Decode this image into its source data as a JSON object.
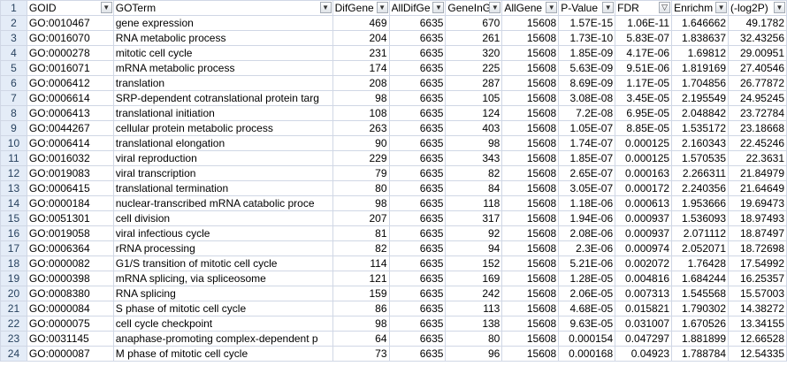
{
  "columns": [
    {
      "label": "GOID",
      "align": "txt",
      "filtered": false
    },
    {
      "label": "GOTerm",
      "align": "txt",
      "filtered": false
    },
    {
      "label": "DifGene",
      "align": "num",
      "filtered": false
    },
    {
      "label": "AllDifGe",
      "align": "num",
      "filtered": false
    },
    {
      "label": "GeneInG",
      "align": "num",
      "filtered": false
    },
    {
      "label": "AllGene",
      "align": "num",
      "filtered": false
    },
    {
      "label": "P-Value",
      "align": "num",
      "filtered": false
    },
    {
      "label": "FDR",
      "align": "num",
      "filtered": true
    },
    {
      "label": "Enrichm",
      "align": "num",
      "filtered": false
    },
    {
      "label": "(-log2P)",
      "align": "num",
      "filtered": false
    }
  ],
  "row_numbers": [
    "1",
    "2",
    "3",
    "4",
    "5",
    "6",
    "7",
    "8",
    "9",
    "10",
    "11",
    "12",
    "13",
    "14",
    "15",
    "16",
    "17",
    "18",
    "19",
    "20",
    "21",
    "22",
    "23",
    "24"
  ],
  "rows": [
    [
      "GO:0010467",
      "gene expression",
      "469",
      "6635",
      "670",
      "15608",
      "1.57E-15",
      "1.06E-11",
      "1.646662",
      "49.1782"
    ],
    [
      "GO:0016070",
      "RNA metabolic process",
      "204",
      "6635",
      "261",
      "15608",
      "1.73E-10",
      "5.83E-07",
      "1.838637",
      "32.43256"
    ],
    [
      "GO:0000278",
      "mitotic cell cycle",
      "231",
      "6635",
      "320",
      "15608",
      "1.85E-09",
      "4.17E-06",
      "1.69812",
      "29.00951"
    ],
    [
      "GO:0016071",
      "mRNA metabolic process",
      "174",
      "6635",
      "225",
      "15608",
      "5.63E-09",
      "9.51E-06",
      "1.819169",
      "27.40546"
    ],
    [
      "GO:0006412",
      "translation",
      "208",
      "6635",
      "287",
      "15608",
      "8.69E-09",
      "1.17E-05",
      "1.704856",
      "26.77872"
    ],
    [
      "GO:0006614",
      "SRP-dependent cotranslational protein targ",
      "98",
      "6635",
      "105",
      "15608",
      "3.08E-08",
      "3.45E-05",
      "2.195549",
      "24.95245"
    ],
    [
      "GO:0006413",
      "translational initiation",
      "108",
      "6635",
      "124",
      "15608",
      "7.2E-08",
      "6.95E-05",
      "2.048842",
      "23.72784"
    ],
    [
      "GO:0044267",
      "cellular protein metabolic process",
      "263",
      "6635",
      "403",
      "15608",
      "1.05E-07",
      "8.85E-05",
      "1.535172",
      "23.18668"
    ],
    [
      "GO:0006414",
      "translational elongation",
      "90",
      "6635",
      "98",
      "15608",
      "1.74E-07",
      "0.000125",
      "2.160343",
      "22.45246"
    ],
    [
      "GO:0016032",
      "viral reproduction",
      "229",
      "6635",
      "343",
      "15608",
      "1.85E-07",
      "0.000125",
      "1.570535",
      "22.3631"
    ],
    [
      "GO:0019083",
      "viral transcription",
      "79",
      "6635",
      "82",
      "15608",
      "2.65E-07",
      "0.000163",
      "2.266311",
      "21.84979"
    ],
    [
      "GO:0006415",
      "translational termination",
      "80",
      "6635",
      "84",
      "15608",
      "3.05E-07",
      "0.000172",
      "2.240356",
      "21.64649"
    ],
    [
      "GO:0000184",
      "nuclear-transcribed mRNA catabolic proce",
      "98",
      "6635",
      "118",
      "15608",
      "1.18E-06",
      "0.000613",
      "1.953666",
      "19.69473"
    ],
    [
      "GO:0051301",
      "cell division",
      "207",
      "6635",
      "317",
      "15608",
      "1.94E-06",
      "0.000937",
      "1.536093",
      "18.97493"
    ],
    [
      "GO:0019058",
      "viral infectious cycle",
      "81",
      "6635",
      "92",
      "15608",
      "2.08E-06",
      "0.000937",
      "2.071112",
      "18.87497"
    ],
    [
      "GO:0006364",
      "rRNA processing",
      "82",
      "6635",
      "94",
      "15608",
      "2.3E-06",
      "0.000974",
      "2.052071",
      "18.72698"
    ],
    [
      "GO:0000082",
      "G1/S transition of mitotic cell cycle",
      "114",
      "6635",
      "152",
      "15608",
      "5.21E-06",
      "0.002072",
      "1.76428",
      "17.54992"
    ],
    [
      "GO:0000398",
      "mRNA splicing, via spliceosome",
      "121",
      "6635",
      "169",
      "15608",
      "1.28E-05",
      "0.004816",
      "1.684244",
      "16.25357"
    ],
    [
      "GO:0008380",
      "RNA splicing",
      "159",
      "6635",
      "242",
      "15608",
      "2.06E-05",
      "0.007313",
      "1.545568",
      "15.57003"
    ],
    [
      "GO:0000084",
      "S phase of mitotic cell cycle",
      "86",
      "6635",
      "113",
      "15608",
      "4.68E-05",
      "0.015821",
      "1.790302",
      "14.38272"
    ],
    [
      "GO:0000075",
      "cell cycle checkpoint",
      "98",
      "6635",
      "138",
      "15608",
      "9.63E-05",
      "0.031007",
      "1.670526",
      "13.34155"
    ],
    [
      "GO:0031145",
      "anaphase-promoting complex-dependent p",
      "64",
      "6635",
      "80",
      "15608",
      "0.000154",
      "0.047297",
      "1.881899",
      "12.66528"
    ],
    [
      "GO:0000087",
      "M phase of mitotic cell cycle",
      "73",
      "6635",
      "96",
      "15608",
      "0.000168",
      "0.04923",
      "1.788784",
      "12.54335"
    ]
  ],
  "icons": {
    "filter": "chevron-down-icon",
    "active_filter": "funnel-icon"
  },
  "colors": {
    "gridline": "#d0d7e5",
    "row_header_bg": "#e4ecf7",
    "row_header_text": "#27415e"
  }
}
